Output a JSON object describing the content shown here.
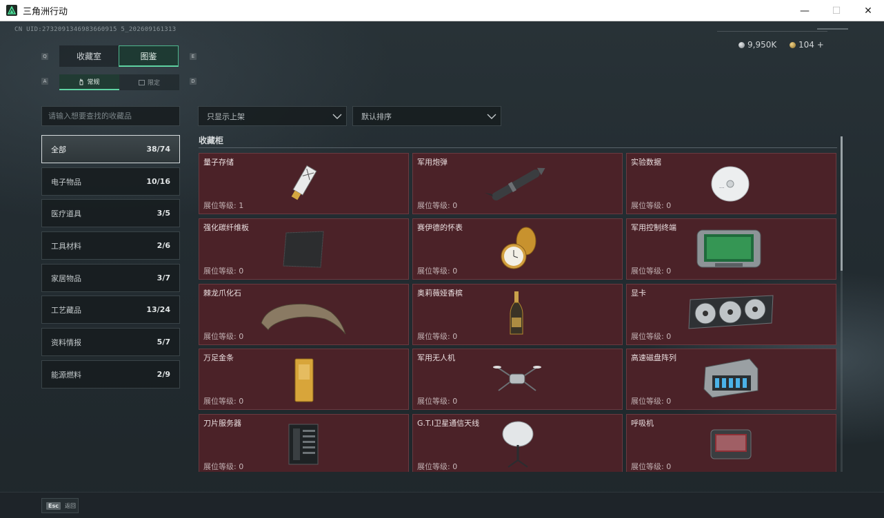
{
  "window": {
    "title": "三角洲行动",
    "minimize": "—",
    "maximize": "☐",
    "close": "✕"
  },
  "uid": "CN UID:2732091346983660915 5_202609161313",
  "currency": {
    "silver": "9,950K",
    "gold": "104 +"
  },
  "hints": {
    "q": "Q",
    "e": "E",
    "a": "A",
    "d": "D"
  },
  "top_tabs": [
    "收藏室",
    "图鉴"
  ],
  "sub_tabs": [
    "常规",
    "限定"
  ],
  "search": {
    "placeholder": "请输入想要查找的收藏品"
  },
  "categories": [
    {
      "label": "全部",
      "count": "38/74"
    },
    {
      "label": "电子物品",
      "count": "10/16"
    },
    {
      "label": "医疗道具",
      "count": "3/5"
    },
    {
      "label": "工具材料",
      "count": "2/6"
    },
    {
      "label": "家居物品",
      "count": "3/7"
    },
    {
      "label": "工艺藏品",
      "count": "13/24"
    },
    {
      "label": "资料情报",
      "count": "5/7"
    },
    {
      "label": "能源燃料",
      "count": "2/9"
    }
  ],
  "filters": {
    "shelf": "只显示上架",
    "sort": "默认排序"
  },
  "section": {
    "title": "收藏柜"
  },
  "level_label": "展位等级:",
  "items": [
    {
      "name": "量子存储",
      "level": "1",
      "icon": "usb-drive-icon"
    },
    {
      "name": "军用炮弹",
      "level": "0",
      "icon": "missile-icon"
    },
    {
      "name": "实验数据",
      "level": "0",
      "icon": "disc-icon"
    },
    {
      "name": "强化碳纤维板",
      "level": "0",
      "icon": "carbon-plate-icon"
    },
    {
      "name": "赛伊德的怀表",
      "level": "0",
      "icon": "pocket-watch-icon"
    },
    {
      "name": "军用控制终端",
      "level": "0",
      "icon": "control-terminal-icon"
    },
    {
      "name": "棘龙爪化石",
      "level": "0",
      "icon": "claw-fossil-icon"
    },
    {
      "name": "奥莉薇娅香槟",
      "level": "0",
      "icon": "champagne-icon"
    },
    {
      "name": "显卡",
      "level": "0",
      "icon": "graphics-card-icon"
    },
    {
      "name": "万足金条",
      "level": "0",
      "icon": "gold-bar-icon"
    },
    {
      "name": "军用无人机",
      "level": "0",
      "icon": "drone-icon"
    },
    {
      "name": "高速磁盘阵列",
      "level": "0",
      "icon": "disk-array-icon"
    },
    {
      "name": "刀片服务器",
      "level": "0",
      "icon": "blade-server-icon"
    },
    {
      "name": "G.T.I卫星通信天线",
      "level": "0",
      "icon": "satellite-dish-icon"
    },
    {
      "name": "呼吸机",
      "level": "0",
      "icon": "ventilator-icon"
    }
  ],
  "footer": {
    "key": "Esc",
    "label": "返回"
  }
}
